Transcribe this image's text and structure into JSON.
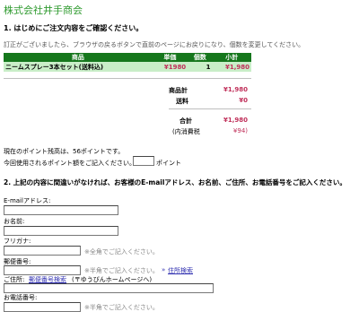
{
  "store_name": "株式会社井手商会",
  "step1": {
    "title": "1. はじめにご注文内容をご確認ください。",
    "notice": "訂正がございましたら、ブラウザの戻るボタンで直前のページにお戻りになり、個数を変更してください。"
  },
  "cart": {
    "headers": {
      "product": "商品",
      "unit_price": "単価",
      "qty": "個数",
      "subtotal": "小計"
    },
    "rows": [
      {
        "product": "ニームスプレー3本セット(送料込)",
        "unit_price": "¥1980",
        "qty": "1",
        "subtotal": "¥1,980"
      }
    ]
  },
  "summary": {
    "goods_total_label": "商品計",
    "goods_total": "¥1,980",
    "shipping_label": "送料",
    "shipping": "¥0",
    "total_label": "合計",
    "total": "¥1,980",
    "tax_label": "(内消費税",
    "tax": "¥94)"
  },
  "points": {
    "current_text": "現在のポイント残高は、56ポイントです。",
    "use_label": "今回使用されるポイント額をご記入ください。",
    "use_value": "",
    "unit": "ポイント"
  },
  "step2": {
    "title": "2. 上記の内容に間違いがなければ、お客様のE-mailアドレス、お名前、ご住所、お電話番号をご記入ください。"
  },
  "form": {
    "email_label": "E-mailアドレス:",
    "name_label": "お名前:",
    "furigana_label": "フリガナ:",
    "furigana_hint": "※全角でご記入ください。",
    "postal_label": "郵便番号:",
    "postal_hint": "※半角でご記入ください。",
    "address_search_link": "住所検索",
    "address_label": "ご住所:",
    "postal_search_link": "郵便番号検索",
    "postal_site_text": "(〒ゆうびんホームページへ)",
    "phone_label": "お電話番号:",
    "phone_hint": "※半角でご記入ください。"
  },
  "colors": {
    "brand_green": "#2e9a2e",
    "table_header": "#15771c",
    "table_row": "#c9eec8",
    "price_red": "#c0305a"
  }
}
